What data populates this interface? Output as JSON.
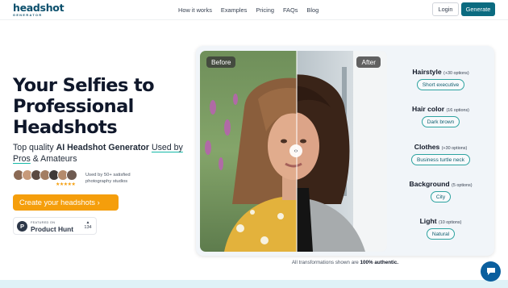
{
  "nav": {
    "logo_main": "headshot",
    "logo_sub": "GENERATOR",
    "links": [
      "How it works",
      "Examples",
      "Pricing",
      "FAQs",
      "Blog"
    ],
    "login_label": "Login",
    "generate_label": "Generate"
  },
  "hero": {
    "title": "Your Selfies to Professional Headshots",
    "sub_prefix": "Top quality ",
    "sub_bold": "AI Headshot Generator",
    "sub_space": " ",
    "sub_link": "Used by Pros",
    "sub_suffix": " & Amateurs",
    "stars": "★★★★★",
    "used_by": "Used by 50+ satisfied photography studios",
    "cta_label": "Create your headshots ›",
    "ph_small": "FEATURED ON",
    "ph_name": "Product Hunt",
    "ph_logo": "P",
    "ph_arrow": "▲",
    "ph_count": "134"
  },
  "preview": {
    "before_label": "Before",
    "after_label": "After",
    "slider_icon": "‹›"
  },
  "options": [
    {
      "title": "Hairstyle",
      "count": "(+30 options)",
      "chip": "Short executive"
    },
    {
      "title": "Hair color",
      "count": "(16 options)",
      "chip": "Dark brown"
    },
    {
      "title": "Clothes",
      "count": "(+30 options)",
      "chip": "Business turtle neck"
    },
    {
      "title": "Background",
      "count": "(5 options)",
      "chip": "City"
    },
    {
      "title": "Light",
      "count": "(10 options)",
      "chip": "Natural"
    }
  ],
  "footnote_prefix": "All transformations shown are ",
  "footnote_bold": "100% authentic.",
  "colors": {
    "brand": "#0b6b80",
    "cta": "#f59e0b",
    "chip_border": "#2ea3a0"
  },
  "icons": {
    "chat": "chat-bubble-icon",
    "slider": "compare-arrows-icon",
    "product_hunt": "product-hunt-logo"
  }
}
